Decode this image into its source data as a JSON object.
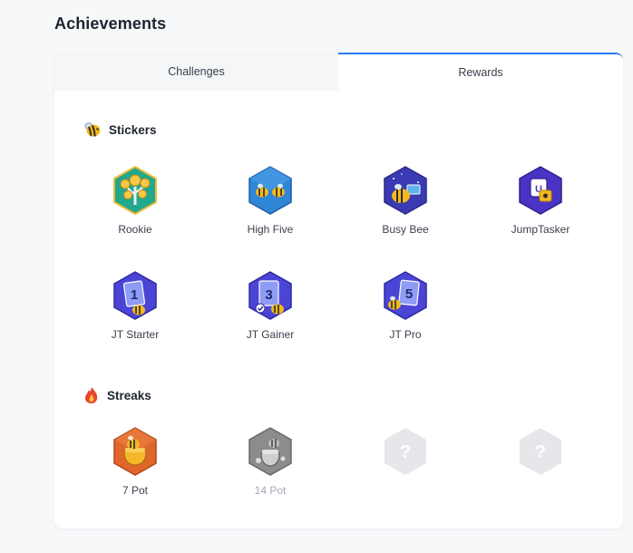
{
  "page": {
    "title": "Achievements"
  },
  "tabs": [
    {
      "label": "Challenges",
      "active": false
    },
    {
      "label": "Rewards",
      "active": true
    }
  ],
  "colors": {
    "active_tab_border": "#2f7cf6",
    "muted_text": "#a4a9b3"
  },
  "sections": {
    "stickers": {
      "title": "Stickers",
      "icon": "bee-icon",
      "items": [
        {
          "name": "Rookie",
          "icon": "money-tree-badge-icon"
        },
        {
          "name": "High Five",
          "icon": "high-five-bees-badge-icon"
        },
        {
          "name": "Busy Bee",
          "icon": "busy-bee-badge-icon"
        },
        {
          "name": "JumpTasker",
          "icon": "jumptasker-badge-icon"
        },
        {
          "name": "JT Starter",
          "icon": "card-1-badge-icon"
        },
        {
          "name": "JT Gainer",
          "icon": "card-3-badge-icon"
        },
        {
          "name": "JT Pro",
          "icon": "card-5-badge-icon"
        }
      ]
    },
    "streaks": {
      "title": "Streaks",
      "icon": "fire-icon",
      "items": [
        {
          "name": "7 Pot",
          "icon": "honey-pot-badge-icon",
          "locked": false
        },
        {
          "name": "14 Pot",
          "icon": "honey-pot-badge-icon",
          "locked": true
        },
        {
          "name": "",
          "icon": "question-mark-badge-icon",
          "locked": true
        },
        {
          "name": "",
          "icon": "question-mark-badge-icon",
          "locked": true
        }
      ]
    }
  }
}
